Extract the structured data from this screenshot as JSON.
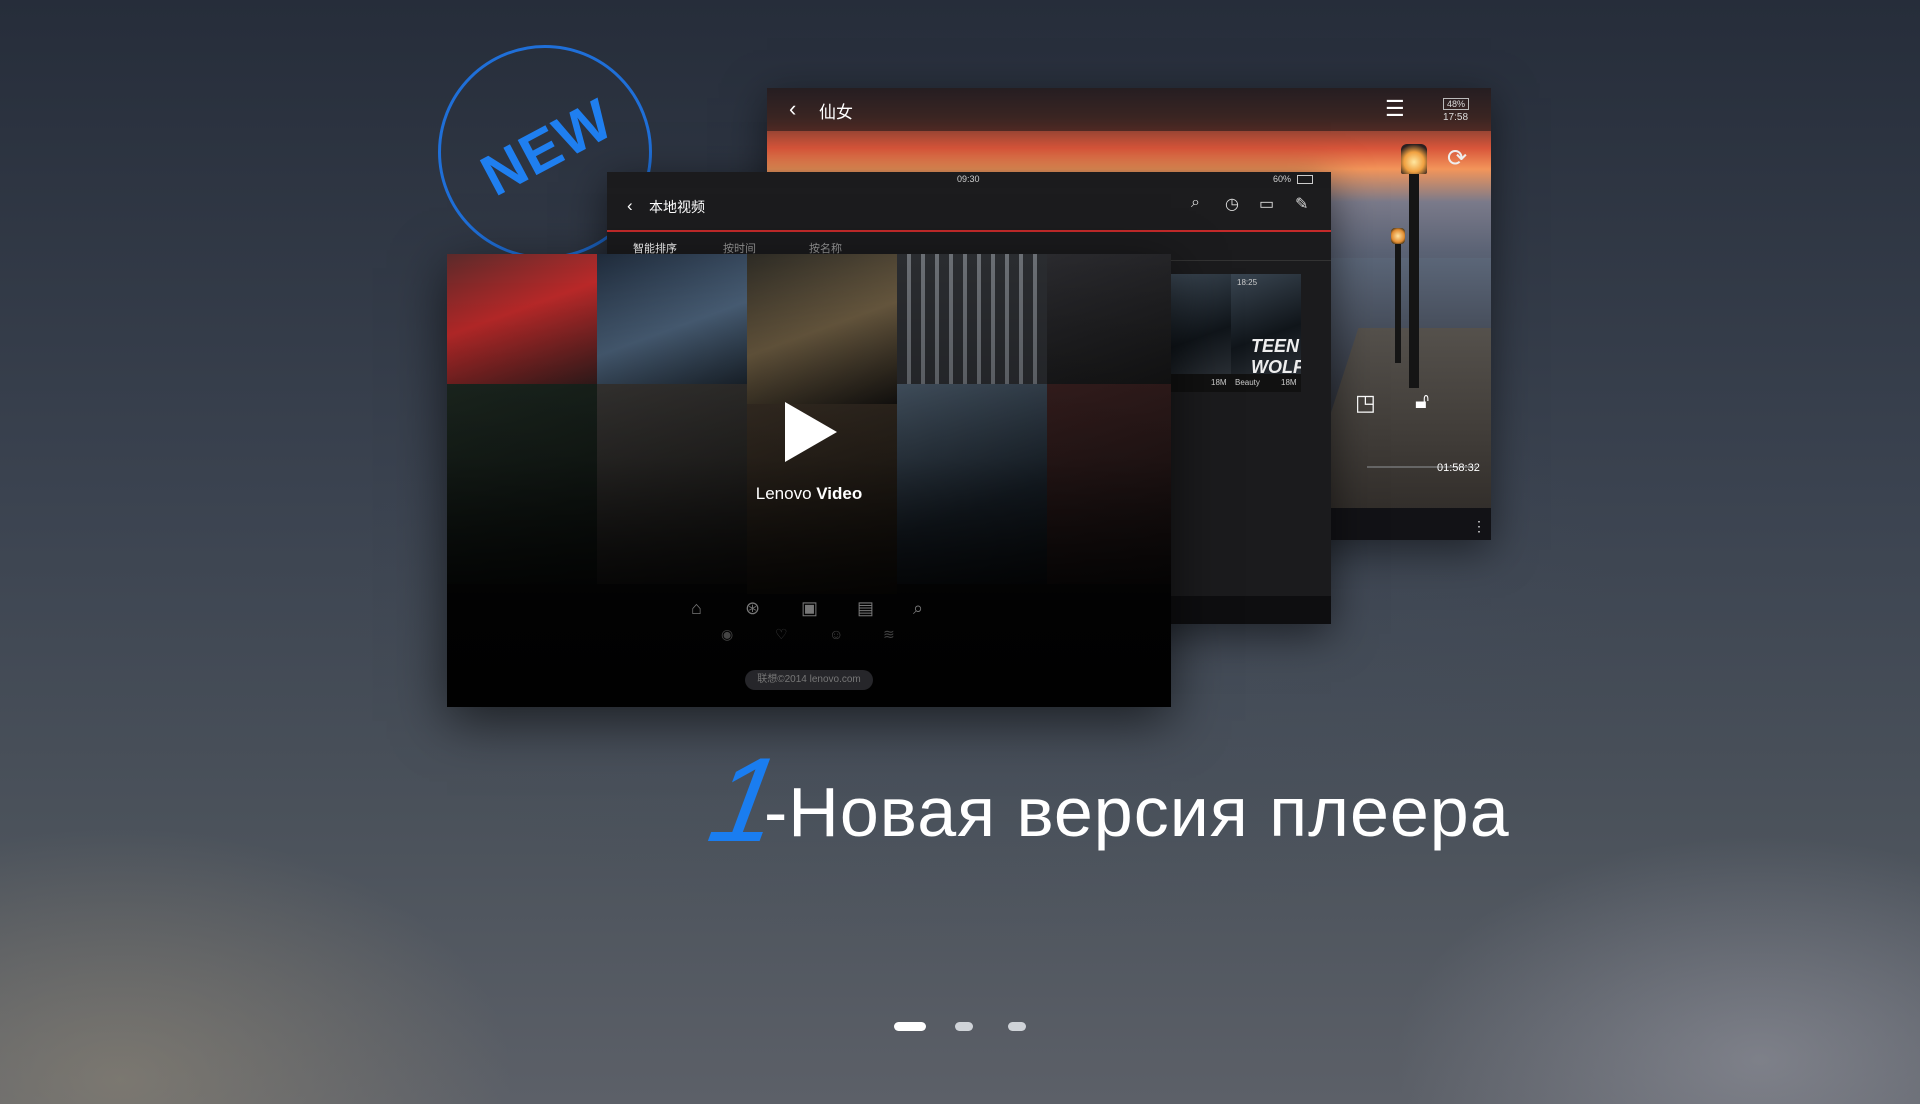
{
  "badge": {
    "text": "NEW",
    "color": "#1f7ff0"
  },
  "player": {
    "title": "仙女",
    "battery": "48%",
    "clock": "17:58",
    "elapsed": "01:58:32",
    "icons": {
      "back": "chevron-left-icon",
      "list": "list-icon",
      "rotate": "rotate-icon",
      "window": "window-icon",
      "lock": "lock-icon",
      "more": "more-icon"
    }
  },
  "local": {
    "status_time": "09:30",
    "status_battery": "60%",
    "title": "本地视频",
    "tabs": [
      "智能排序",
      "按时间",
      "按名称"
    ],
    "thumbs": [
      {
        "size": "18M",
        "name": ""
      },
      {
        "duration": "18:25",
        "size": "18M",
        "name": "Beauty",
        "poster_text": "TEEN WOLF"
      }
    ],
    "icons": [
      "search-icon",
      "history-icon",
      "camera-icon",
      "edit-icon"
    ]
  },
  "splash": {
    "brand_light": "Lenovo",
    "brand_bold": "Video",
    "copyright": "联想©2014 lenovo.com"
  },
  "headline": {
    "number": "1",
    "text": "-Новая версия плеера",
    "accent": "#1a7df0"
  },
  "pagination": {
    "total": 3,
    "current": 1
  }
}
